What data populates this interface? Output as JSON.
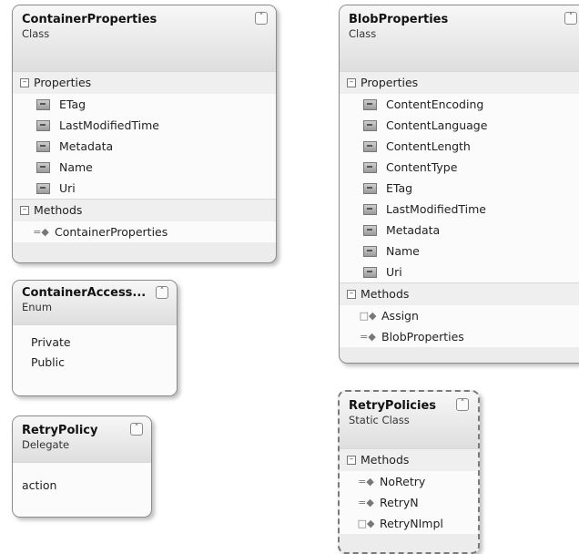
{
  "container_properties": {
    "title": "ContainerProperties",
    "kind": "Class",
    "properties_label": "Properties",
    "properties": [
      "ETag",
      "LastModifiedTime",
      "Metadata",
      "Name",
      "Uri"
    ],
    "methods_label": "Methods",
    "methods": [
      "ContainerProperties"
    ]
  },
  "blob_properties": {
    "title": "BlobProperties",
    "kind": "Class",
    "properties_label": "Properties",
    "properties": [
      "ContentEncoding",
      "ContentLanguage",
      "ContentLength",
      "ContentType",
      "ETag",
      "LastModifiedTime",
      "Metadata",
      "Name",
      "Uri"
    ],
    "methods_label": "Methods",
    "methods": [
      "Assign",
      "BlobProperties"
    ]
  },
  "container_access": {
    "title": "ContainerAccess...",
    "kind": "Enum",
    "values": [
      "Private",
      "Public"
    ]
  },
  "retry_policy": {
    "title": "RetryPolicy",
    "kind": "Delegate",
    "params": [
      "action"
    ]
  },
  "retry_policies": {
    "title": "RetryPolicies",
    "kind": "Static Class",
    "methods_label": "Methods",
    "methods": [
      "NoRetry",
      "RetryN",
      "RetryNImpl"
    ]
  },
  "icons": {
    "collapse": "double-chevron-up-icon",
    "expand_toggle": "minus-box-icon",
    "property": "property-icon",
    "method": "method-icon"
  }
}
